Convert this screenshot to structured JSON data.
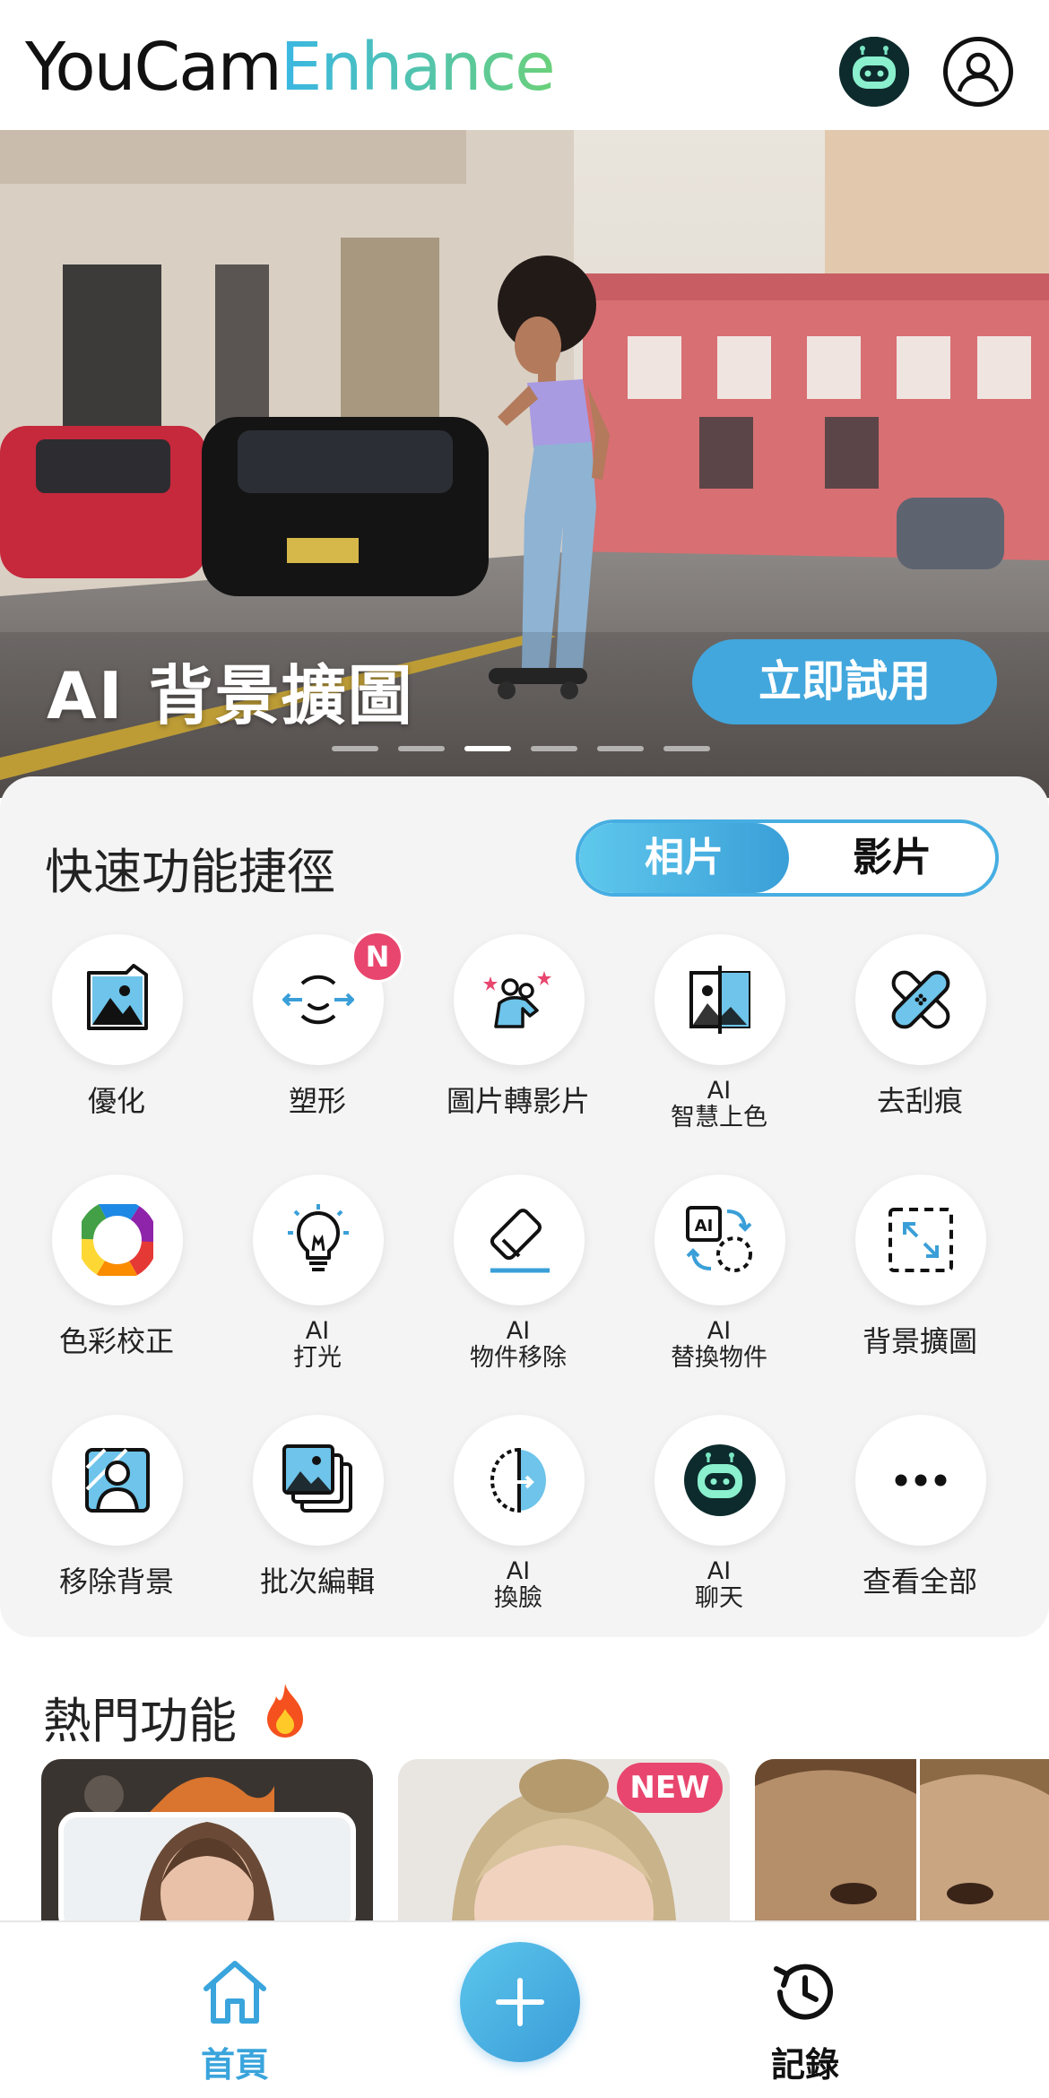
{
  "header": {
    "logo_part1": "YouCam",
    "logo_part2": "Enhance",
    "ai_chat_icon": "robot-face-icon",
    "profile_icon": "user-avatar-icon"
  },
  "banner": {
    "title": "AI 背景擴圖",
    "cta_label": "立即試用",
    "slide_count": 6,
    "active_slide": 3
  },
  "quick": {
    "title": "快速功能捷徑",
    "toggle": {
      "photo": "相片",
      "video": "影片",
      "selected": "相片"
    },
    "tools": [
      {
        "label": "優化",
        "icon": "photo-enhance-icon"
      },
      {
        "label": "塑形",
        "icon": "face-reshape-icon",
        "badge": "N"
      },
      {
        "label": "圖片轉影片",
        "icon": "photo-to-video-icon"
      },
      {
        "label_line1": "AI",
        "label_line2": "智慧上色",
        "icon": "colorize-icon"
      },
      {
        "label": "去刮痕",
        "icon": "bandage-icon"
      },
      {
        "label": "色彩校正",
        "icon": "color-wheel-icon"
      },
      {
        "label_line1": "AI",
        "label_line2": "打光",
        "icon": "light-bulb-icon"
      },
      {
        "label_line1": "AI",
        "label_line2": "物件移除",
        "icon": "eraser-icon"
      },
      {
        "label_line1": "AI",
        "label_line2": "替換物件",
        "icon": "replace-object-icon"
      },
      {
        "label": "背景擴圖",
        "icon": "expand-frame-icon"
      },
      {
        "label": "移除背景",
        "icon": "remove-background-icon"
      },
      {
        "label": "批次編輯",
        "icon": "batch-edit-icon"
      },
      {
        "label_line1": "AI",
        "label_line2": "換臉",
        "icon": "face-swap-icon"
      },
      {
        "label_line1": "AI",
        "label_line2": "聊天",
        "icon": "robot-face-icon"
      },
      {
        "label": "查看全部",
        "icon": "more-dots-icon"
      }
    ]
  },
  "hot": {
    "title": "熱門功能",
    "fire_icon": "fire-icon",
    "new_badge": "NEW"
  },
  "nav": {
    "home": "首頁",
    "records": "記錄",
    "add_icon": "plus-icon"
  },
  "colors": {
    "accent": "#42a7dd",
    "badge": "#e8466e",
    "panel_bg": "#f4f4f4"
  }
}
